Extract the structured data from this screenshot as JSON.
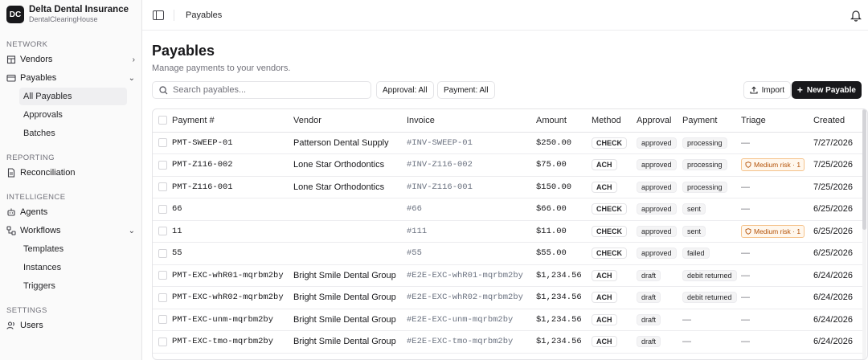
{
  "org": {
    "initials": "DC",
    "name": "Delta Dental Insurance",
    "subtitle": "DentalClearingHouse"
  },
  "sidebar": {
    "network_label": "NETWORK",
    "vendors": "Vendors",
    "payables": "Payables",
    "payables_children": [
      "All Payables",
      "Approvals",
      "Batches"
    ],
    "reporting_label": "REPORTING",
    "reconciliation": "Reconciliation",
    "intelligence_label": "INTELLIGENCE",
    "agents": "Agents",
    "workflows": "Workflows",
    "workflows_children": [
      "Templates",
      "Instances",
      "Triggers"
    ],
    "settings_label": "SETTINGS",
    "users": "Users"
  },
  "topbar": {
    "breadcrumb": "Payables"
  },
  "page": {
    "title": "Payables",
    "subtitle": "Manage payments to your vendors."
  },
  "toolbar": {
    "search_placeholder": "Search payables...",
    "approval_filter": "Approval: All",
    "payment_filter": "Payment: All",
    "import_label": "Import",
    "new_label": "New Payable"
  },
  "table": {
    "headers": [
      "Payment #",
      "Vendor",
      "Invoice",
      "Amount",
      "Method",
      "Approval",
      "Payment",
      "Triage",
      "Created"
    ],
    "rows": [
      {
        "id": "PMT-SWEEP-01",
        "vendor": "Patterson Dental Supply",
        "invoice": "#INV-SWEEP-01",
        "amount": "$250.00",
        "method": "CHECK",
        "approval": "approved",
        "payment": "processing",
        "triage": "—",
        "created": "7/27/2026"
      },
      {
        "id": "PMT-Z116-002",
        "vendor": "Lone Star Orthodontics",
        "invoice": "#INV-Z116-002",
        "amount": "$75.00",
        "method": "ACH",
        "approval": "approved",
        "payment": "processing",
        "triage": "Medium risk · 1",
        "created": "7/25/2026"
      },
      {
        "id": "PMT-Z116-001",
        "vendor": "Lone Star Orthodontics",
        "invoice": "#INV-Z116-001",
        "amount": "$150.00",
        "method": "ACH",
        "approval": "approved",
        "payment": "processing",
        "triage": "—",
        "created": "7/25/2026"
      },
      {
        "id": "66",
        "vendor": "",
        "invoice": "#66",
        "amount": "$66.00",
        "method": "CHECK",
        "approval": "approved",
        "payment": "sent",
        "triage": "—",
        "created": "6/25/2026"
      },
      {
        "id": "11",
        "vendor": "",
        "invoice": "#111",
        "amount": "$11.00",
        "method": "CHECK",
        "approval": "approved",
        "payment": "sent",
        "triage": "Medium risk · 1",
        "created": "6/25/2026"
      },
      {
        "id": "55",
        "vendor": "",
        "invoice": "#55",
        "amount": "$55.00",
        "method": "CHECK",
        "approval": "approved",
        "payment": "failed",
        "triage": "—",
        "created": "6/25/2026"
      },
      {
        "id": "PMT-EXC-whR01-mqrbm2by",
        "vendor": "Bright Smile Dental Group",
        "invoice": "#E2E-EXC-whR01-mqrbm2by",
        "amount": "$1,234.56",
        "method": "ACH",
        "approval": "draft",
        "payment": "debit returned",
        "triage": "—",
        "created": "6/24/2026"
      },
      {
        "id": "PMT-EXC-whR02-mqrbm2by",
        "vendor": "Bright Smile Dental Group",
        "invoice": "#E2E-EXC-whR02-mqrbm2by",
        "amount": "$1,234.56",
        "method": "ACH",
        "approval": "draft",
        "payment": "debit returned",
        "triage": "—",
        "created": "6/24/2026"
      },
      {
        "id": "PMT-EXC-unm-mqrbm2by",
        "vendor": "Bright Smile Dental Group",
        "invoice": "#E2E-EXC-unm-mqrbm2by",
        "amount": "$1,234.56",
        "method": "ACH",
        "approval": "draft",
        "payment": "—",
        "triage": "—",
        "created": "6/24/2026"
      },
      {
        "id": "PMT-EXC-tmo-mqrbm2by",
        "vendor": "Bright Smile Dental Group",
        "invoice": "#E2E-EXC-tmo-mqrbm2by",
        "amount": "$1,234.56",
        "method": "ACH",
        "approval": "draft",
        "payment": "—",
        "triage": "—",
        "created": "6/24/2026"
      }
    ]
  }
}
